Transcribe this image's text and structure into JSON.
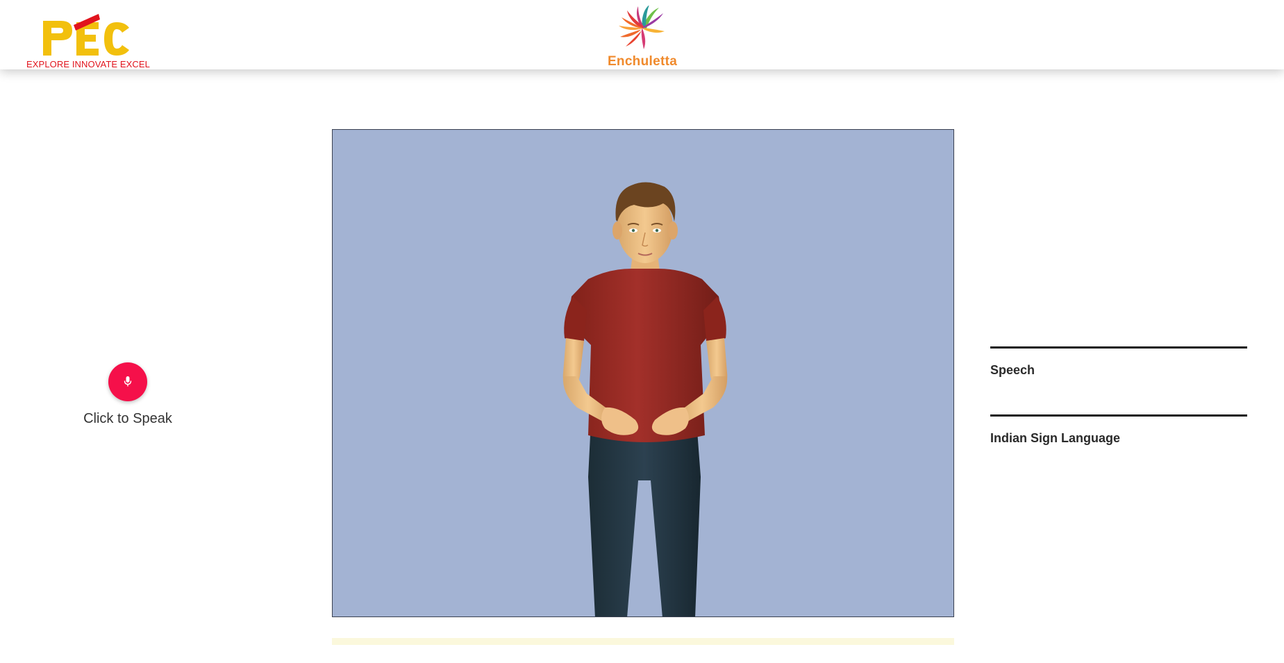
{
  "header": {
    "institution_logo": {
      "letters": "PEC",
      "tagline": "EXPLORE INNOVATE EXCEL",
      "colors": {
        "letters": "#f2c00d",
        "accent": "#e1141d",
        "tagline": "#e1141d"
      }
    },
    "brand": {
      "name": "Enchuletta",
      "icon": "swirl-flower-icon",
      "color": "#f08a2c"
    }
  },
  "speech_input": {
    "button_icon": "microphone-icon",
    "button_color": "#f5104a",
    "label": "Click to Speak"
  },
  "avatar_stage": {
    "background": "#a3b3d3",
    "progress_bar_color": "#fbf8dc"
  },
  "output_panel": {
    "speech": {
      "heading": "Speech",
      "text": ""
    },
    "sign_language": {
      "heading": "Indian Sign Language",
      "text": ""
    }
  }
}
